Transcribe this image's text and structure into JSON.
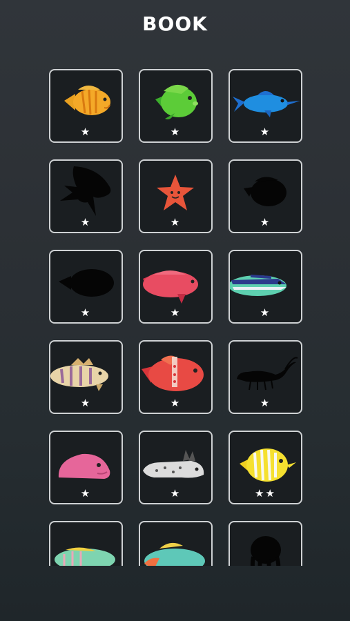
{
  "header": {
    "title": "BOOK"
  },
  "cards": [
    {
      "name": "orange-tang-fish",
      "stars": "★",
      "discovered": true
    },
    {
      "name": "green-discus-fish",
      "stars": "★",
      "discovered": true
    },
    {
      "name": "blue-swordfish",
      "stars": "★",
      "discovered": true
    },
    {
      "name": "angelfish-silhouette",
      "stars": "★",
      "discovered": false
    },
    {
      "name": "starfish",
      "stars": "★",
      "discovered": true
    },
    {
      "name": "surgeonfish-silhouette",
      "stars": "★",
      "discovered": false
    },
    {
      "name": "puffer-silhouette",
      "stars": "★",
      "discovered": false
    },
    {
      "name": "red-grouper-fish",
      "stars": "★",
      "discovered": true
    },
    {
      "name": "striped-wrasse-fish",
      "stars": "★",
      "discovered": true
    },
    {
      "name": "striped-bass-fish",
      "stars": "★",
      "discovered": true
    },
    {
      "name": "red-spotted-fish",
      "stars": "★",
      "discovered": true
    },
    {
      "name": "shrimp-silhouette",
      "stars": "★",
      "discovered": false
    },
    {
      "name": "pink-blobfish",
      "stars": "★",
      "discovered": true
    },
    {
      "name": "sea-slug",
      "stars": "★",
      "discovered": true
    },
    {
      "name": "butterfly-fish",
      "stars": "★★",
      "discovered": true
    },
    {
      "name": "green-parrotfish",
      "stars": "",
      "discovered": true
    },
    {
      "name": "rainbow-parrotfish",
      "stars": "",
      "discovered": true
    },
    {
      "name": "octopus-silhouette",
      "stars": "",
      "discovered": false
    }
  ]
}
